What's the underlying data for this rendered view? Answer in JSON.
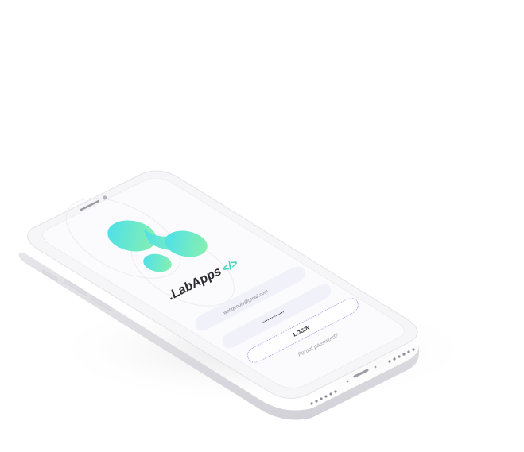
{
  "app": {
    "brand_name": ".LabApps",
    "brand_code_glyph": "</>"
  },
  "login_form": {
    "email_value": "webgenuis@gmail.com",
    "password_value": "••••••••••••••••",
    "login_label": "LOGIN",
    "forgot_password_label": "Forgot password?"
  },
  "colors": {
    "gradient_start": "#4fe0e8",
    "gradient_end": "#7ef0b8",
    "brand_accent": "#45d6b8",
    "button_border": "#b8a6f0",
    "field_fill": "#f1f2f9",
    "phone_body": "#f4f4f6"
  }
}
